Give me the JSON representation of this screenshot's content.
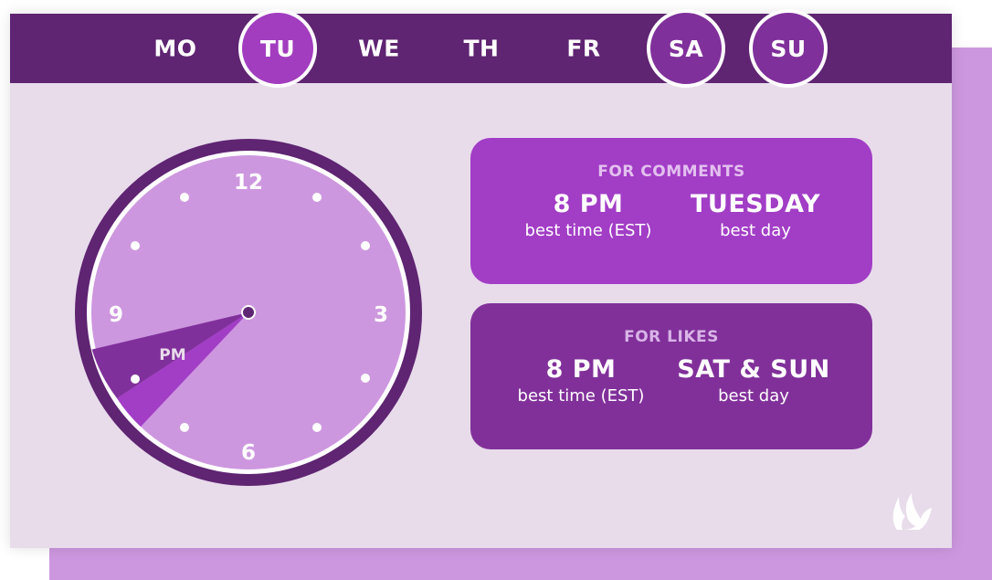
{
  "days": [
    {
      "label": "MO",
      "active": false
    },
    {
      "label": "TU",
      "active": true
    },
    {
      "label": "WE",
      "active": false
    },
    {
      "label": "TH",
      "active": false
    },
    {
      "label": "FR",
      "active": false
    },
    {
      "label": "SA",
      "active": true
    },
    {
      "label": "SU",
      "active": true
    }
  ],
  "clock": {
    "numbers": {
      "twelve": "12",
      "three": "3",
      "six": "6",
      "nine": "9"
    },
    "highlight_label": "PM",
    "hand_time": "8 PM"
  },
  "comments": {
    "heading": "FOR COMMENTS",
    "time_value": "8 PM",
    "time_caption": "best time (EST)",
    "day_value": "TUESDAY",
    "day_caption": "best day"
  },
  "likes": {
    "heading": "FOR LIKES",
    "time_value": "8 PM",
    "time_caption": "best time (EST)",
    "day_value": "SAT & SUN",
    "day_caption": "best day"
  },
  "colors": {
    "dark_purple": "#5f2472",
    "active_tuesday": "#a23dbf",
    "active_weekend": "#80309b",
    "card_background": "#e8dceb",
    "clock_face": "#cd97df",
    "comments_card": "#a23dc6",
    "likes_card": "#81309a"
  },
  "icons": {
    "logo": "flame-logo-icon"
  }
}
